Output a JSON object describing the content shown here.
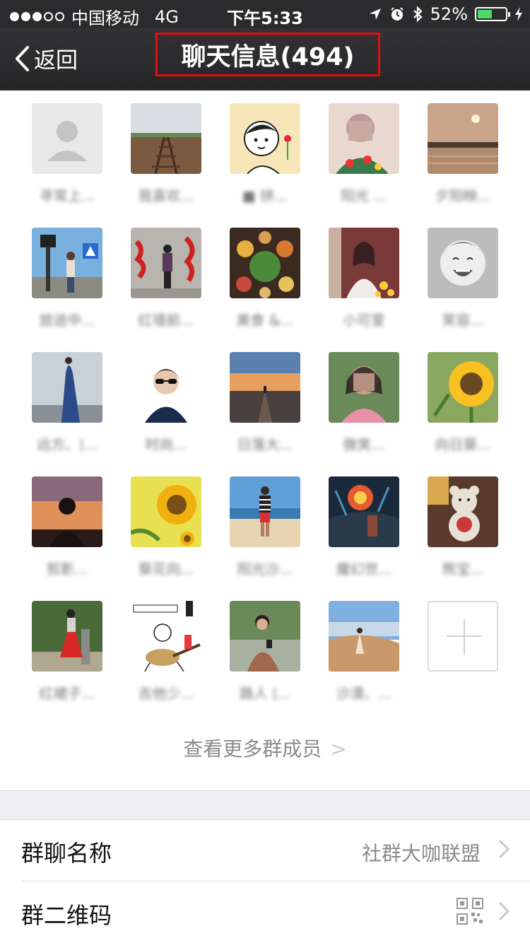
{
  "status_bar": {
    "carrier": "中国移动",
    "network": "4G",
    "time": "下午5:33",
    "battery": "52%",
    "battery_level": 0.52,
    "icons": [
      "signal-dots-icon",
      "location-arrow-icon",
      "alarm-icon",
      "bluetooth-icon",
      "battery-icon",
      "charging-bolt-icon"
    ]
  },
  "nav": {
    "back_label": "返回",
    "title": "聊天信息(494)"
  },
  "members": [
    {
      "name": "寻常上...",
      "avatar": "placeholder-person"
    },
    {
      "name": "我喜欢...",
      "avatar": "railway"
    },
    {
      "name": "■ 拼...",
      "avatar": "cartoon-boy"
    },
    {
      "name": "阳光 ...",
      "avatar": "floral-woman"
    },
    {
      "name": "夕阳映...",
      "avatar": "sunset-river"
    },
    {
      "name": "旅途中...",
      "avatar": "man-street"
    },
    {
      "name": "红墙前...",
      "avatar": "woman-red-wall"
    },
    {
      "name": "美食 &...",
      "avatar": "food-table"
    },
    {
      "name": "小可爱",
      "avatar": "woman-flowers"
    },
    {
      "name": "笑容...",
      "avatar": "laughing-girl"
    },
    {
      "name": "远方、|...",
      "avatar": "figure-sky"
    },
    {
      "name": "时尚...",
      "avatar": "woman-sunglasses"
    },
    {
      "name": "日落大...",
      "avatar": "road-sunset"
    },
    {
      "name": "微笑...",
      "avatar": "woman-pink"
    },
    {
      "name": "向日葵...",
      "avatar": "sunflower"
    },
    {
      "name": "剪影...",
      "avatar": "silhouette-sunset"
    },
    {
      "name": "葵花向...",
      "avatar": "sunflower-2"
    },
    {
      "name": "阳光沙...",
      "avatar": "man-beach"
    },
    {
      "name": "魔幻世...",
      "avatar": "fantasy-scene"
    },
    {
      "name": "熊宝...",
      "avatar": "teddy-bear"
    },
    {
      "name": "红裙子...",
      "avatar": "woman-red-skirt"
    },
    {
      "name": "吉他少...",
      "avatar": "guitar-sketch"
    },
    {
      "name": "路人 |...",
      "avatar": "man-phone"
    },
    {
      "name": "沙漠、...",
      "avatar": "desert-woman"
    }
  ],
  "add_member_icon": "plus-icon",
  "more_members": "查看更多群成员",
  "settings": {
    "group_name_label": "群聊名称",
    "group_name_value": "社群大咖联盟",
    "qr_label": "群二维码"
  },
  "colors": {
    "nav_bg": "#2b2b2d",
    "highlight": "#e30e0e",
    "battery_green": "#4cd964"
  }
}
